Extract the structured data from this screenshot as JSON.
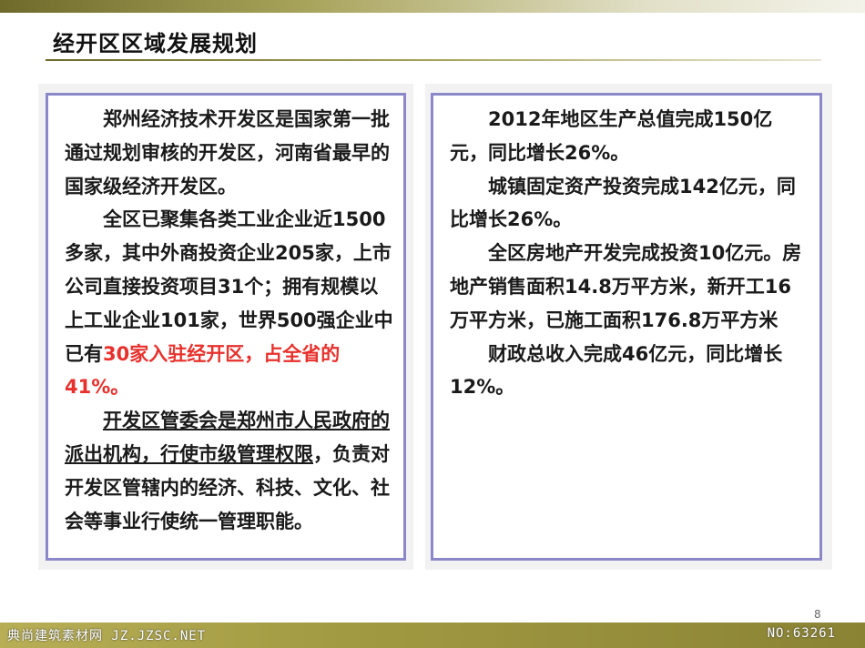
{
  "slide": {
    "title": "经开区区域发展规划",
    "page_number": "8"
  },
  "left_card": {
    "para1": "郑州经济技术开发区是国家第一批通过规划审核的开发区，河南省最早的国家级经济开发区。",
    "para2_normal": "全区已聚集各类工业企业近1500多家，其中外商投资企业205家，上市公司直接投资项目31个；拥有规模以上工业企业101家，世界500强企业中已有",
    "para2_red": "30家入驻经开区，占全省的41%。",
    "para3_underlined": "开发区管委会是郑州市人民政府的派出机构，行使市级管理权限",
    "para3_rest": "，负责对开发区管辖内的经济、科技、文化、社会等事业行使统一管理职能。"
  },
  "right_card": {
    "para1": "2012年地区生产总值完成150亿元，同比增长26%。",
    "para2": "城镇固定资产投资完成142亿元，同比增长26%。",
    "para3": "全区房地产开发完成投资10亿元。房地产销售面积14.8万平方米，新开工16万平方米，已施工面积176.8万平方米",
    "para4": "财政总收入完成46亿元，同比增长12%。"
  },
  "watermark": {
    "left": "典尚建筑素材网 JZ.JZSC.NET",
    "right": "NO:63261"
  },
  "colors": {
    "card_border": "#8a88c8",
    "highlight": "#e8302c",
    "band": "#a29a42"
  }
}
